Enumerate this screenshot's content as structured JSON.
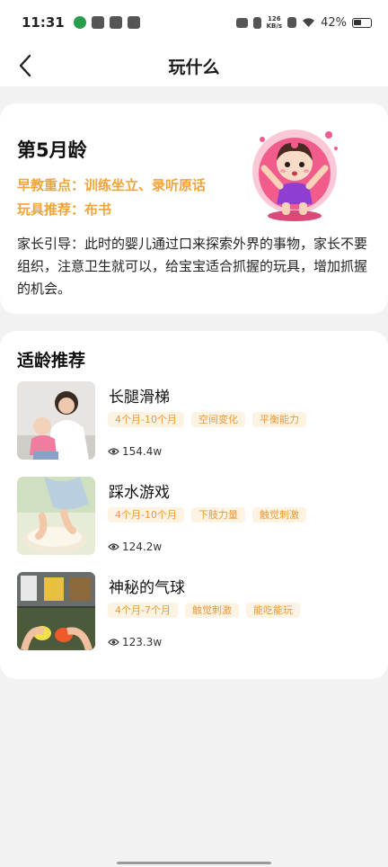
{
  "status_bar": {
    "time": "11:31",
    "net_speed_value": "126",
    "net_speed_unit": "KB/s",
    "battery_percent": "42%"
  },
  "nav": {
    "title": "玩什么",
    "back_icon": "chevron-left-icon"
  },
  "stage": {
    "title": "第5月龄",
    "focus": "早教重点：训练坐立、录听原话",
    "toy": "玩具推荐：布书",
    "guide": "家长引导：此时的婴儿通过口来探索外界的事物，家长不要组织，注意卫生就可以，给宝宝适合抓握的玩具，增加抓握的机会。"
  },
  "recommend": {
    "title": "适龄推荐",
    "items": [
      {
        "name": "长腿滑梯",
        "tags": [
          "4个月-10个月",
          "空间变化",
          "平衡能力"
        ],
        "views": "154.4w"
      },
      {
        "name": "踩水游戏",
        "tags": [
          "4个月-10个月",
          "下肢力量",
          "触觉刺激"
        ],
        "views": "124.2w"
      },
      {
        "name": "神秘的气球",
        "tags": [
          "4个月-7个月",
          "触觉刺激",
          "能吃能玩"
        ],
        "views": "123.3w"
      }
    ]
  },
  "colors": {
    "accent_orange": "#f0a43a",
    "tag_bg": "#fdf3e3",
    "tag_text": "#e99a3c",
    "illustration_pink": "#f25c8c"
  }
}
